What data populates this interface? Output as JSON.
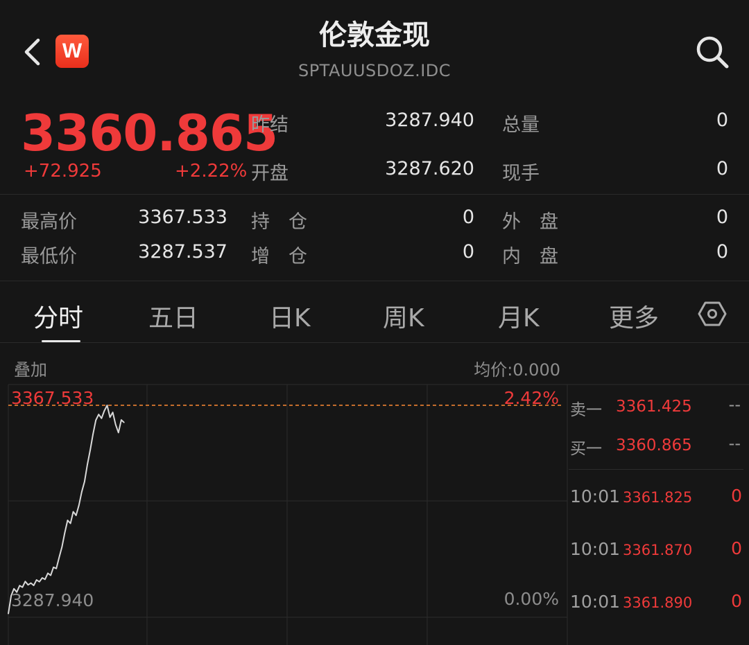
{
  "header": {
    "title": "伦敦金现",
    "code": "SPTAUUSDOZ.IDC",
    "logo_letter": "W"
  },
  "quote": {
    "last_price": "3360.865",
    "change": "+72.925",
    "change_pct": "+2.22%",
    "fields": [
      {
        "label": "昨结",
        "value": "3287.940"
      },
      {
        "label": "开盘",
        "value": "3287.620"
      },
      {
        "label": "总量",
        "value": "0"
      },
      {
        "label": "现手",
        "value": "0"
      },
      {
        "label": "最高价",
        "value": "3367.533"
      },
      {
        "label": "最低价",
        "value": "3287.537"
      },
      {
        "label": "持　仓",
        "value": "0"
      },
      {
        "label": "增　仓",
        "value": "0"
      },
      {
        "label": "外　盘",
        "value": "0"
      },
      {
        "label": "内　盘",
        "value": "0"
      }
    ]
  },
  "tabs": [
    {
      "label": "分时",
      "active": true
    },
    {
      "label": "五日"
    },
    {
      "label": "日K"
    },
    {
      "label": "周K"
    },
    {
      "label": "月K"
    },
    {
      "label": "更多"
    }
  ],
  "chart": {
    "overlay_label": "叠加",
    "avg_price_label": "均价:0.000",
    "high_label": "3367.533",
    "high_pct": "2.42%",
    "base_label": "3287.940",
    "base_pct": "0.00%"
  },
  "order_book": {
    "ask_label": "卖一",
    "ask_price": "3361.425",
    "ask_qty": "--",
    "bid_label": "买一",
    "bid_price": "3360.865",
    "bid_qty": "--",
    "ticks": [
      {
        "time": "10:01",
        "price": "3361.825",
        "qty": "0"
      },
      {
        "time": "10:01",
        "price": "3361.870",
        "qty": "0"
      },
      {
        "time": "10:01",
        "price": "3361.890",
        "qty": "0"
      }
    ]
  },
  "chart_data": {
    "type": "line",
    "series": [
      {
        "values": [
          3287.2,
          3294.1,
          3296.8,
          3295.5,
          3298.0,
          3297.4,
          3299.6,
          3298.3,
          3299.0,
          3298.1,
          3300.2,
          3299.5,
          3301.0,
          3300.4,
          3302.8,
          3302.0,
          3305.1,
          3304.6,
          3308.9,
          3313.0,
          3318.4,
          3323.2,
          3322.0,
          3326.5,
          3325.1,
          3329.0,
          3334.2,
          3338.1,
          3344.7,
          3350.3,
          3356.4,
          3361.8,
          3364.0,
          3362.5,
          3365.4,
          3367.5,
          3362.9,
          3364.8,
          3360.1,
          3357.0,
          3361.9,
          3360.9
        ]
      }
    ],
    "ylim": [
      3287.94,
      3367.533
    ],
    "reference_lines": [
      3367.533
    ],
    "grid": true
  },
  "colors": {
    "up": "#ef3a3a",
    "background": "#161616",
    "line": "#d9d9d9",
    "grid": "#2c2c2c",
    "reference_line": "#ff8a33"
  },
  "icons": {
    "back": "chevron-left-icon",
    "search": "search-icon",
    "settings": "hexagon-settings-icon"
  }
}
